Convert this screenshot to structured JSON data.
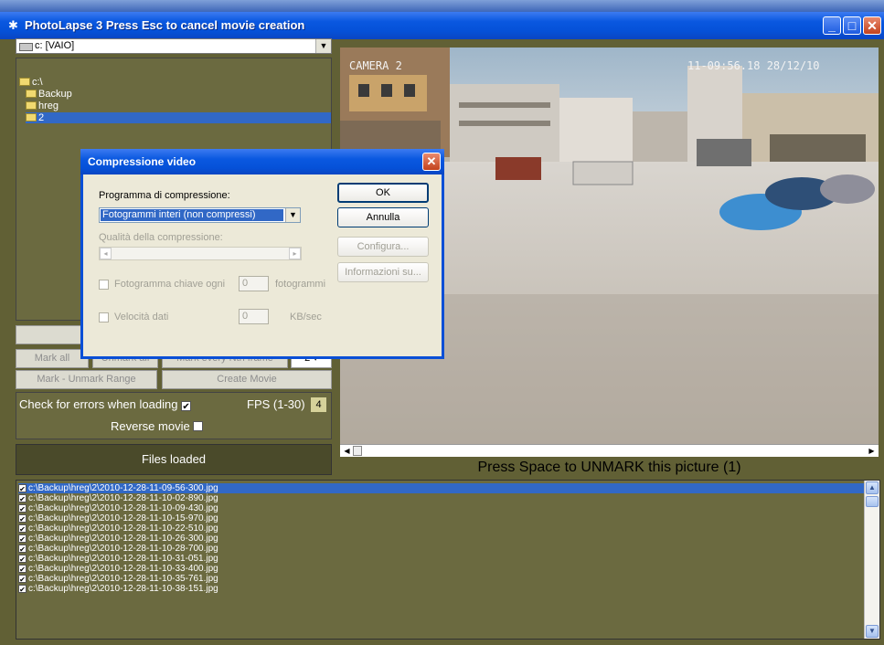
{
  "window": {
    "title": "PhotoLapse 3  Press Esc to cancel movie creation",
    "colors": {
      "titlebar": "#0a58e0",
      "panel": "#6b6a40",
      "selection": "#3168c6"
    }
  },
  "drive": {
    "value": "c: [VAIO]"
  },
  "folder_tree": [
    {
      "label": "c:\\",
      "selected": false
    },
    {
      "label": "Backup",
      "selected": false
    },
    {
      "label": "hreg",
      "selected": false
    },
    {
      "label": "2",
      "selected": true
    }
  ],
  "buttons": {
    "mark_all": "Mark all",
    "unmark_all": "Unmark all",
    "mark_every": "Mark every Nth frame",
    "mark_every_value": "2",
    "mark_range": "Mark - Unmark Range",
    "create_movie": "Create Movie"
  },
  "options": {
    "check_errors_label": "Check for errors when loading",
    "check_errors_checked": "✔",
    "fps_label": "FPS (1-30)",
    "fps_value": "4",
    "reverse_label": "Reverse movie"
  },
  "status": {
    "files_loaded": "Files loaded",
    "press_space": "Press Space to UNMARK this picture (1)"
  },
  "preview": {
    "camera_label": "CAMERA 2",
    "timestamp": "11-09:56.18 28/12/10"
  },
  "files": [
    "c:\\Backup\\hreg\\2\\2010-12-28-11-09-56-300.jpg",
    "c:\\Backup\\hreg\\2\\2010-12-28-11-10-02-890.jpg",
    "c:\\Backup\\hreg\\2\\2010-12-28-11-10-09-430.jpg",
    "c:\\Backup\\hreg\\2\\2010-12-28-11-10-15-970.jpg",
    "c:\\Backup\\hreg\\2\\2010-12-28-11-10-22-510.jpg",
    "c:\\Backup\\hreg\\2\\2010-12-28-11-10-26-300.jpg",
    "c:\\Backup\\hreg\\2\\2010-12-28-11-10-28-700.jpg",
    "c:\\Backup\\hreg\\2\\2010-12-28-11-10-31-051.jpg",
    "c:\\Backup\\hreg\\2\\2010-12-28-11-10-33-400.jpg",
    "c:\\Backup\\hreg\\2\\2010-12-28-11-10-35-761.jpg",
    "c:\\Backup\\hreg\\2\\2010-12-28-11-10-38-151.jpg"
  ],
  "dialog": {
    "title": "Compressione video",
    "compressor_label": "Programma di compressione:",
    "compressor_value": "Fotogrammi interi (non compressi)",
    "quality_label": "Qualità della compressione:",
    "keyframe_label": "Fotogramma chiave ogni",
    "keyframe_value": "0",
    "keyframe_unit": "fotogrammi",
    "datarate_label": "Velocità dati",
    "datarate_value": "0",
    "datarate_unit": "KB/sec",
    "ok": "OK",
    "cancel": "Annulla",
    "configure": "Configura...",
    "info": "Informazioni su..."
  }
}
